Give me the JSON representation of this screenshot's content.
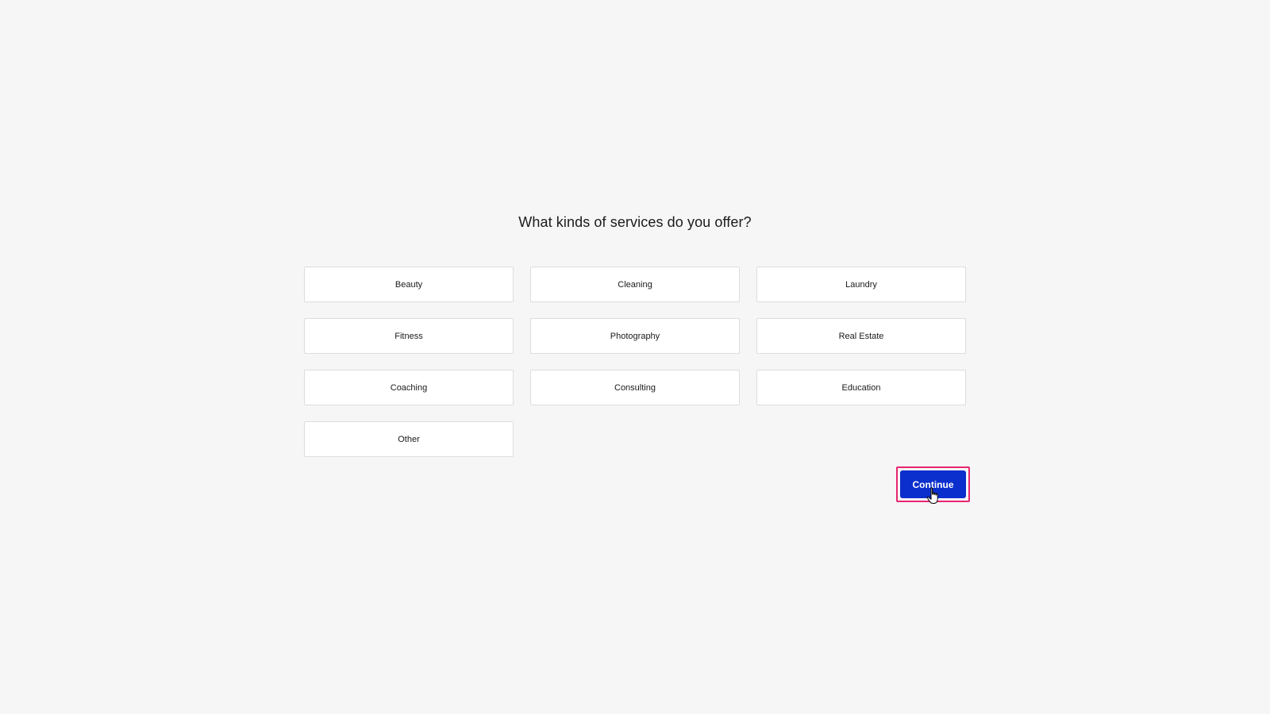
{
  "question": "What kinds of services do you offer?",
  "options": [
    {
      "label": "Beauty"
    },
    {
      "label": "Cleaning"
    },
    {
      "label": "Laundry"
    },
    {
      "label": "Fitness"
    },
    {
      "label": "Photography"
    },
    {
      "label": "Real Estate"
    },
    {
      "label": "Coaching"
    },
    {
      "label": "Consulting"
    },
    {
      "label": "Education"
    },
    {
      "label": "Other"
    }
  ],
  "continue_label": "Continue",
  "colors": {
    "background": "#f6f6f6",
    "primary_button": "#0a2fcc",
    "highlight_outline": "#e8266f"
  },
  "cursor_icon": "hand-pointer-icon"
}
